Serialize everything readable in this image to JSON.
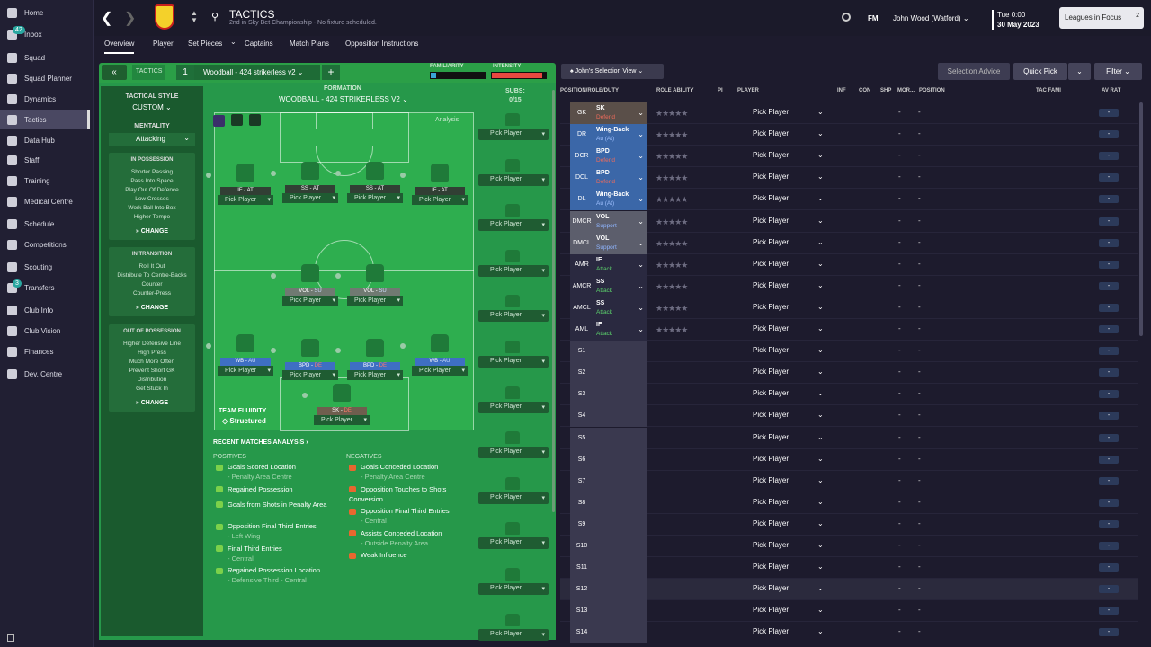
{
  "sidebar": {
    "items": [
      {
        "label": "Home",
        "icon": "home-icon"
      },
      {
        "label": "Inbox",
        "icon": "inbox-icon",
        "badge": "42"
      },
      {
        "label": "Squad",
        "icon": "squad-icon"
      },
      {
        "label": "Squad Planner",
        "icon": "planner-icon"
      },
      {
        "label": "Dynamics",
        "icon": "dynamics-icon"
      },
      {
        "label": "Tactics",
        "icon": "tactics-icon",
        "active": true
      },
      {
        "label": "Data Hub",
        "icon": "data-hub-icon"
      },
      {
        "label": "Staff",
        "icon": "staff-icon"
      },
      {
        "label": "Training",
        "icon": "training-icon"
      },
      {
        "label": "Medical Centre",
        "icon": "medical-icon"
      },
      {
        "label": "Schedule",
        "icon": "schedule-icon"
      },
      {
        "label": "Competitions",
        "icon": "trophy-icon"
      },
      {
        "label": "Scouting",
        "icon": "scouting-icon"
      },
      {
        "label": "Transfers",
        "icon": "transfers-icon",
        "badge": "3"
      },
      {
        "label": "Club Info",
        "icon": "club-info-icon"
      },
      {
        "label": "Club Vision",
        "icon": "club-vision-icon"
      },
      {
        "label": "Finances",
        "icon": "finances-icon"
      },
      {
        "label": "Dev. Centre",
        "icon": "dev-centre-icon"
      }
    ]
  },
  "header": {
    "title": "TACTICS",
    "subtitle": "2nd in Sky Bet Championship - No fixture scheduled.",
    "fm": "FM",
    "manager": "John Wood (Watford)",
    "time": "Tue 0:00",
    "date": "30 May 2023",
    "leagues": "Leagues in Focus",
    "leagues_count": "2"
  },
  "tabs": [
    "Overview",
    "Player",
    "Set Pieces",
    "Captains",
    "Match Plans",
    "Opposition Instructions"
  ],
  "tactic": {
    "label": "TACTICS",
    "number": "1",
    "name": "Woodball - 424 strikerless v2",
    "familiarity": "FAMILIARITY",
    "intensity": "INTENSITY",
    "intensity_level": 0.93,
    "familiarity_level": 0.1
  },
  "style": {
    "heading": "TACTICAL STYLE",
    "value": "CUSTOM",
    "mentality_label": "MENTALITY",
    "mentality": "Attacking"
  },
  "cards": [
    {
      "title": "IN POSSESSION",
      "items": [
        "Shorter Passing",
        "Pass Into Space",
        "Play Out Of Defence",
        "Low Crosses",
        "Work Ball Into Box",
        "Higher Tempo"
      ],
      "change": "CHANGE"
    },
    {
      "title": "IN TRANSITION",
      "items": [
        "Roll It Out",
        "Distribute To Centre-Backs",
        "Counter",
        "Counter-Press"
      ],
      "change": "CHANGE"
    },
    {
      "title": "OUT OF POSSESSION",
      "items": [
        "Higher Defensive Line",
        "High Press",
        "Much More Often",
        "Prevent Short GK",
        "Distribution",
        "Get Stuck In"
      ],
      "change": "CHANGE"
    }
  ],
  "formation": {
    "label": "FORMATION",
    "name": "WOODBALL - 424 STRIKERLESS V2",
    "subs_label": "SUBS:",
    "subs_count": "0/15",
    "analysis": "Analysis",
    "fluidity_label": "TEAM FLUIDITY",
    "fluidity": "Structured"
  },
  "pitch_players": [
    {
      "role": "IF",
      "duty": "AT",
      "name": "Pick Player",
      "style": "dark"
    },
    {
      "role": "SS",
      "duty": "AT",
      "name": "Pick Player",
      "style": "dark"
    },
    {
      "role": "SS",
      "duty": "AT",
      "name": "Pick Player",
      "style": "dark"
    },
    {
      "role": "IF",
      "duty": "AT",
      "name": "Pick Player",
      "style": "dark"
    },
    {
      "role": "VOL",
      "duty": "SU",
      "name": "Pick Player",
      "style": "gray"
    },
    {
      "role": "VOL",
      "duty": "SU",
      "name": "Pick Player",
      "style": "gray"
    },
    {
      "role": "WB",
      "duty": "AU",
      "name": "Pick Player",
      "style": "blue"
    },
    {
      "role": "BPD",
      "duty": "DE",
      "name": "Pick Player",
      "style": "blue"
    },
    {
      "role": "BPD",
      "duty": "DE",
      "name": "Pick Player",
      "style": "blue"
    },
    {
      "role": "WB",
      "duty": "AU",
      "name": "Pick Player",
      "style": "blue"
    },
    {
      "role": "SK",
      "duty": "DE",
      "name": "Pick Player",
      "style": "brown"
    }
  ],
  "subs_slots": [
    "Pick Player",
    "Pick Player",
    "Pick Player",
    "Pick Player",
    "Pick Player",
    "Pick Player",
    "Pick Player",
    "Pick Player",
    "Pick Player",
    "Pick Player",
    "Pick Player",
    "Pick Player"
  ],
  "analysis": {
    "heading": "RECENT MATCHES ANALYSIS",
    "positives_label": "POSITIVES",
    "negatives_label": "NEGATIVES",
    "positives": [
      {
        "t": "Goals Scored Location",
        "s": "- Penalty Area Centre"
      },
      {
        "t": "Regained Possession",
        "s": ""
      },
      {
        "t": "Goals from Shots in Penalty Area",
        "s": ""
      },
      {
        "t": "Opposition Final Third Entries",
        "s": "- Left Wing"
      },
      {
        "t": "Final Third Entries",
        "s": "- Central"
      },
      {
        "t": "Regained Possession Location",
        "s": "- Defensive Third - Central"
      }
    ],
    "negatives": [
      {
        "t": "Goals Conceded Location",
        "s": "- Penalty Area Centre"
      },
      {
        "t": "Opposition Touches to Shots Conversion",
        "s": ""
      },
      {
        "t": "Opposition Final Third Entries",
        "s": "- Central"
      },
      {
        "t": "Assists Conceded Location",
        "s": "- Outside Penalty Area"
      },
      {
        "t": "Weak Influence",
        "s": ""
      }
    ]
  },
  "right": {
    "selection_view": "John's Selection View",
    "selection_advice": "Selection Advice",
    "quick_pick": "Quick Pick",
    "filter": "Filter",
    "columns": [
      "POSITION/ROLE/DUTY",
      "ROLE ABILITY",
      "PI",
      "PLAYER",
      "INF",
      "CON",
      "SHP",
      "MOR...",
      "POSITION",
      "TAC FAMI",
      "AV RAT"
    ]
  },
  "rows": [
    {
      "pos": "GK",
      "role": "SK",
      "duty": "Defend",
      "bg": "#5a4f49",
      "dc": "#ef6b5b"
    },
    {
      "pos": "DR",
      "role": "Wing-Back",
      "duty": "Au (At)",
      "bg": "#3b67a8",
      "dc": "#9fc0ff"
    },
    {
      "pos": "DCR",
      "role": "BPD",
      "duty": "Defend",
      "bg": "#3b67a8",
      "dc": "#ef6b5b"
    },
    {
      "pos": "DCL",
      "role": "BPD",
      "duty": "Defend",
      "bg": "#3b67a8",
      "dc": "#ef6b5b"
    },
    {
      "pos": "DL",
      "role": "Wing-Back",
      "duty": "Au (At)",
      "bg": "#3b67a8",
      "dc": "#9fc0ff"
    },
    {
      "pos": "DMCR",
      "role": "VOL",
      "duty": "Support",
      "bg": "#5c5e6c",
      "dc": "#8fb5ff"
    },
    {
      "pos": "DMCL",
      "role": "VOL",
      "duty": "Support",
      "bg": "#5c5e6c",
      "dc": "#8fb5ff"
    },
    {
      "pos": "AMR",
      "role": "IF",
      "duty": "Attack",
      "bg": "#2a2940",
      "dc": "#5cd36c"
    },
    {
      "pos": "AMCR",
      "role": "SS",
      "duty": "Attack",
      "bg": "#2a2940",
      "dc": "#5cd36c"
    },
    {
      "pos": "AMCL",
      "role": "SS",
      "duty": "Attack",
      "bg": "#2a2940",
      "dc": "#5cd36c"
    },
    {
      "pos": "AML",
      "role": "IF",
      "duty": "Attack",
      "bg": "#2a2940",
      "dc": "#5cd36c"
    },
    {
      "pos": "S1"
    },
    {
      "pos": "S2"
    },
    {
      "pos": "S3"
    },
    {
      "pos": "S4"
    },
    {
      "pos": "S5"
    },
    {
      "pos": "S6"
    },
    {
      "pos": "S7"
    },
    {
      "pos": "S8"
    },
    {
      "pos": "S9"
    },
    {
      "pos": "S10"
    },
    {
      "pos": "S11"
    },
    {
      "pos": "S12"
    },
    {
      "pos": "S13"
    },
    {
      "pos": "S14"
    }
  ],
  "row_player": "Pick Player",
  "dash": "-",
  "stars": "★★★★★"
}
